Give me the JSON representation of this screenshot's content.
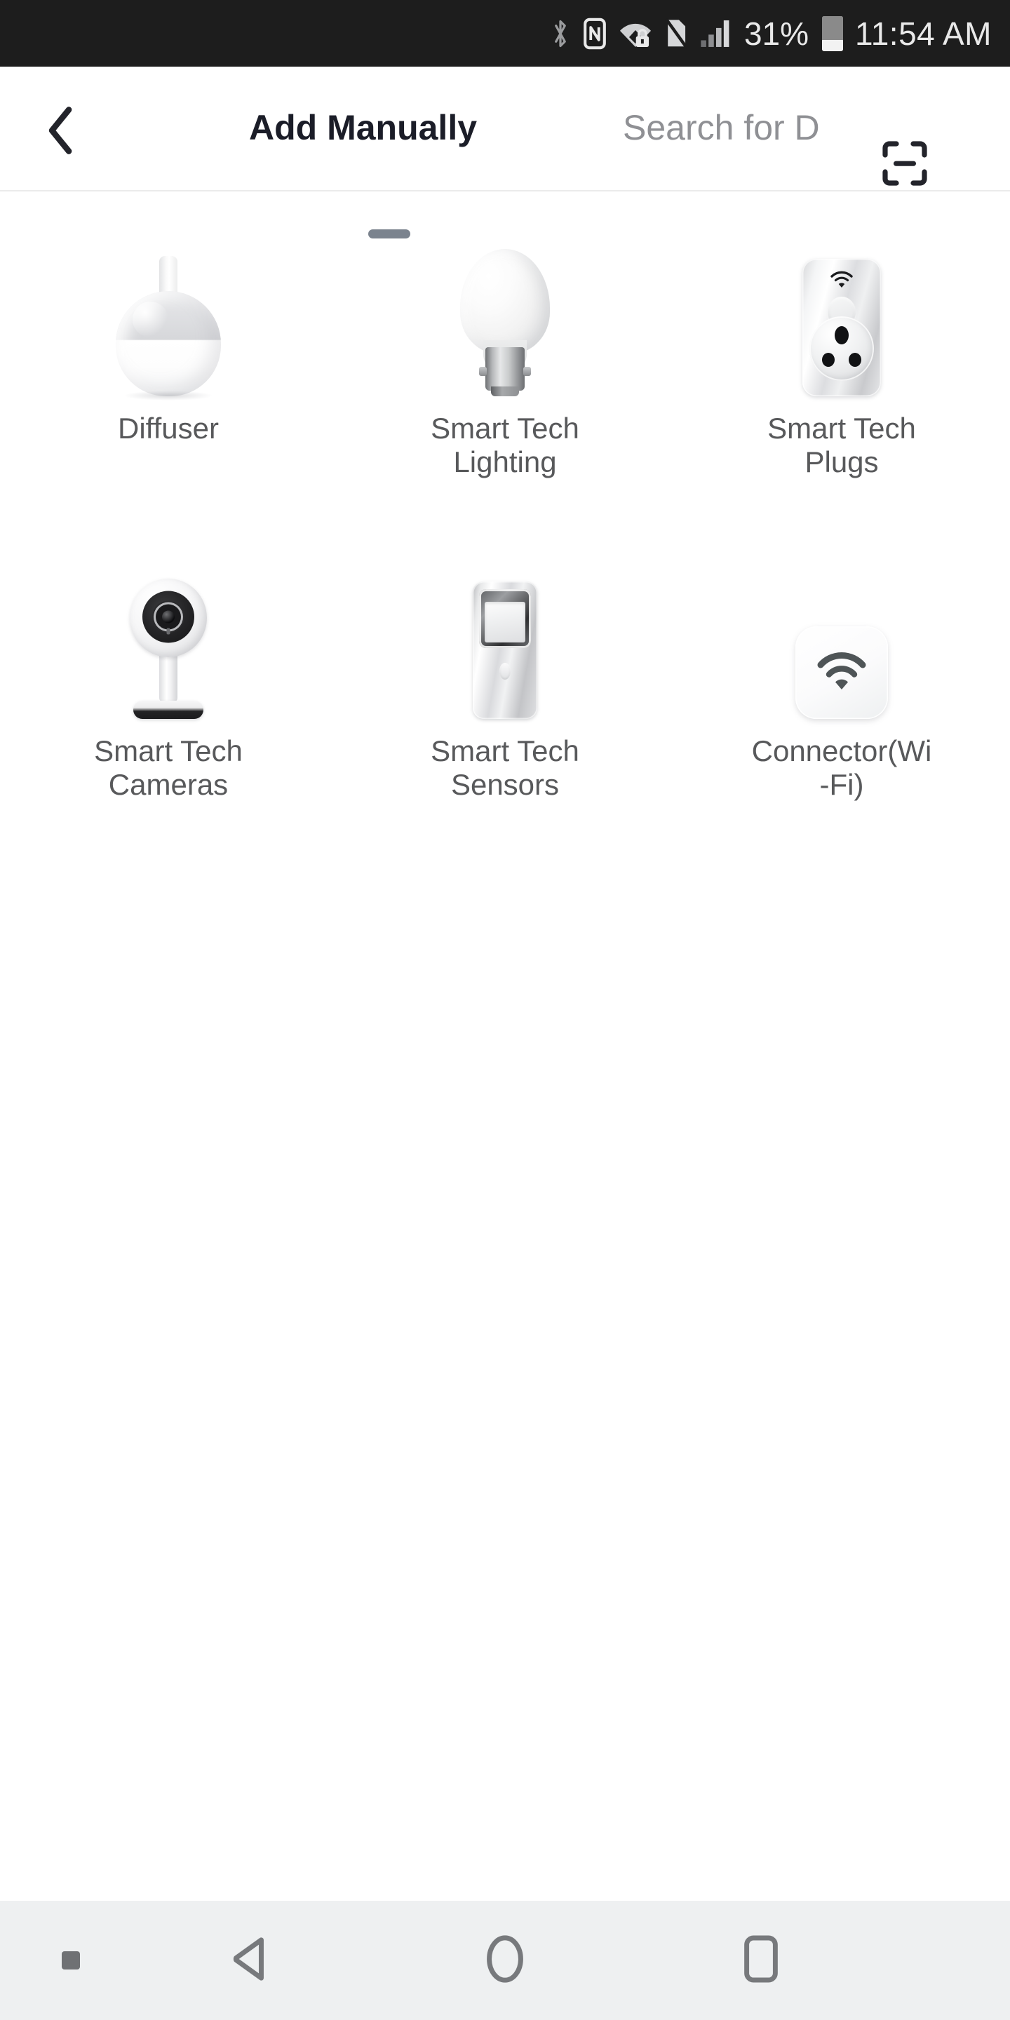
{
  "status_bar": {
    "icons": [
      "bluetooth-icon",
      "nfc-icon",
      "wifi-locked-icon",
      "no-sim-icon",
      "cellular-signal-icon"
    ],
    "battery_percent": "31%",
    "battery_level": 31,
    "time": "11:54 AM"
  },
  "header": {
    "back_icon": "back-chevron-icon",
    "tabs": [
      {
        "label": "Add Manually",
        "active": true
      },
      {
        "label": "Search for D",
        "active": false
      }
    ],
    "scan_icon": "scan-qr-icon"
  },
  "grid": {
    "items": [
      {
        "label": "Diffuser",
        "icon": "diffuser-icon"
      },
      {
        "label": "Smart Tech Lighting",
        "icon": "light-bulb-icon"
      },
      {
        "label": "Smart Tech Plugs",
        "icon": "smart-plug-icon"
      },
      {
        "label": "Smart Tech Cameras",
        "icon": "security-camera-icon"
      },
      {
        "label": "Smart Tech Sensors",
        "icon": "motion-sensor-icon"
      },
      {
        "label": "Connector(Wi-Fi)",
        "icon": "wifi-connector-icon"
      }
    ]
  },
  "nav_bar": {
    "pin_icon": "nav-pin-icon",
    "back_icon": "nav-back-triangle-icon",
    "home_icon": "nav-home-circle-icon",
    "recents_icon": "nav-recents-square-icon"
  },
  "colors": {
    "status_bar_bg": "#1d1d1d",
    "page_bg": "#ffffff",
    "nav_bar_bg": "#eef0f1",
    "active_tab": "#1b1d28",
    "inactive_tab": "#8f9094",
    "label_text": "#58595b",
    "tab_indicator": "#7b838e",
    "divider": "#ebebeb"
  }
}
